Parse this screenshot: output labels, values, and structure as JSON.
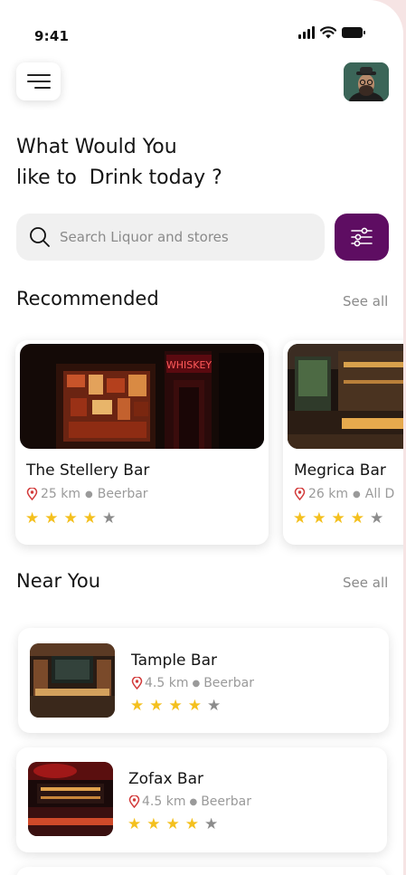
{
  "status_bar": {
    "time": "9:41"
  },
  "header": {
    "menu_icon": "hamburger-menu-icon",
    "avatar_icon": "user-avatar"
  },
  "headline": {
    "line1": "What Would You",
    "line2": "like to  Drink today ?"
  },
  "search": {
    "placeholder": "Search Liquor and stores",
    "icon": "search-icon",
    "filter_icon": "sliders-icon"
  },
  "recommended": {
    "title": "Recommended",
    "see_all": "See all",
    "items": [
      {
        "name": "The Stellery Bar",
        "distance": "25 km",
        "type": "Beerbar",
        "rating": 4,
        "sign": "WHISKEY"
      },
      {
        "name": "Megrica Bar",
        "distance": "26 km",
        "type": "All D",
        "rating": 4
      }
    ]
  },
  "near_you": {
    "title": "Near You",
    "see_all": "See all",
    "items": [
      {
        "name": "Tample Bar",
        "distance": "4.5 km",
        "type": "Beerbar",
        "rating": 4
      },
      {
        "name": "Zofax Bar",
        "distance": "4.5 km",
        "type": "Beerbar",
        "rating": 4
      }
    ]
  },
  "colors": {
    "accent": "#5e0d62",
    "star": "#f4c01e",
    "star_off": "#8c8c8c",
    "pin": "#d23a3a"
  }
}
